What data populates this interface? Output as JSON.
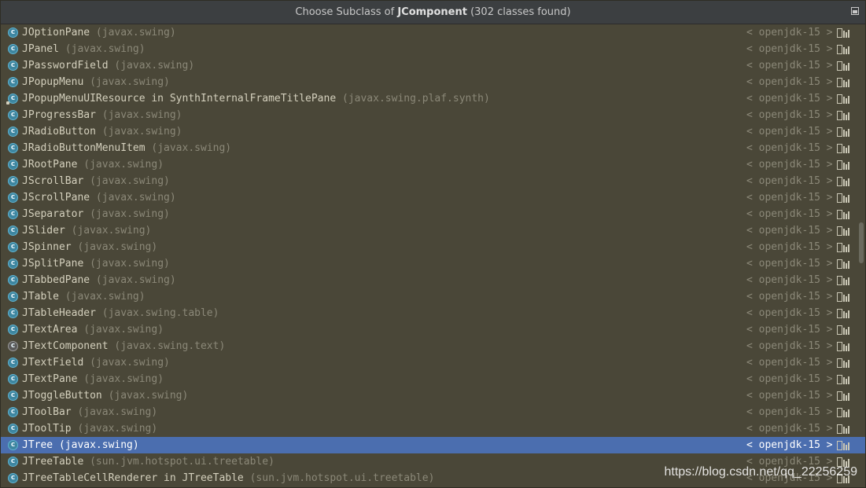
{
  "title": {
    "prefix": "Choose Subclass of ",
    "class": "JComponent",
    "suffix": " (302 classes found)"
  },
  "location_label": "< openjdk-15 >",
  "rows": [
    {
      "name": "JOptionPane",
      "pkg": "(javax.swing)"
    },
    {
      "name": "JPanel",
      "pkg": "(javax.swing)"
    },
    {
      "name": "JPasswordField",
      "pkg": "(javax.swing)"
    },
    {
      "name": "JPopupMenu",
      "pkg": "(javax.swing)"
    },
    {
      "name": "JPopupMenuUIResource in SynthInternalFrameTitlePane",
      "pkg": "(javax.swing.plaf.synth)"
    },
    {
      "name": "JProgressBar",
      "pkg": "(javax.swing)"
    },
    {
      "name": "JRadioButton",
      "pkg": "(javax.swing)"
    },
    {
      "name": "JRadioButtonMenuItem",
      "pkg": "(javax.swing)"
    },
    {
      "name": "JRootPane",
      "pkg": "(javax.swing)"
    },
    {
      "name": "JScrollBar",
      "pkg": "(javax.swing)"
    },
    {
      "name": "JScrollPane",
      "pkg": "(javax.swing)"
    },
    {
      "name": "JSeparator",
      "pkg": "(javax.swing)"
    },
    {
      "name": "JSlider",
      "pkg": "(javax.swing)"
    },
    {
      "name": "JSpinner",
      "pkg": "(javax.swing)"
    },
    {
      "name": "JSplitPane",
      "pkg": "(javax.swing)"
    },
    {
      "name": "JTabbedPane",
      "pkg": "(javax.swing)"
    },
    {
      "name": "JTable",
      "pkg": "(javax.swing)"
    },
    {
      "name": "JTableHeader",
      "pkg": "(javax.swing.table)"
    },
    {
      "name": "JTextArea",
      "pkg": "(javax.swing)"
    },
    {
      "name": "JTextComponent",
      "pkg": "(javax.swing.text)"
    },
    {
      "name": "JTextField",
      "pkg": "(javax.swing)"
    },
    {
      "name": "JTextPane",
      "pkg": "(javax.swing)"
    },
    {
      "name": "JToggleButton",
      "pkg": "(javax.swing)"
    },
    {
      "name": "JToolBar",
      "pkg": "(javax.swing)"
    },
    {
      "name": "JToolTip",
      "pkg": "(javax.swing)"
    },
    {
      "name": "JTree",
      "pkg": "(javax.swing)"
    },
    {
      "name": "JTreeTable",
      "pkg": "(sun.jvm.hotspot.ui.treetable)"
    },
    {
      "name": "JTreeTableCellRenderer in JTreeTable",
      "pkg": "(sun.jvm.hotspot.ui.treetable)"
    }
  ],
  "watermark": "https://blog.csdn.net/qq_22256259",
  "colors": {
    "background": "#4a4738",
    "selection": "#4b6eaf",
    "class_icon": "#3e86a0"
  }
}
